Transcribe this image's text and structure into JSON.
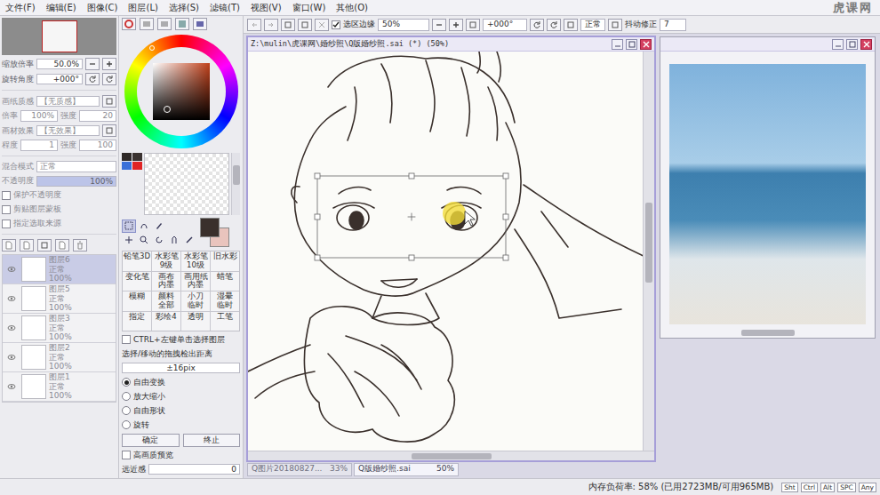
{
  "menu": [
    "文件(F)",
    "编辑(E)",
    "图像(C)",
    "图层(L)",
    "选择(S)",
    "滤镜(T)",
    "视图(V)",
    "窗口(W)",
    "其他(O)"
  ],
  "watermark": "虎课网",
  "toolbar": {
    "selection_edge": {
      "label": "选区边缘",
      "checked": true
    },
    "zoom": "50%",
    "rotation": "+000°",
    "blend": "正常",
    "stabilizer_label": "抖动修正",
    "stabilizer": "7"
  },
  "navigator": {
    "zoom_label": "缩放倍率",
    "zoom": "50.0%",
    "rotate_label": "旋转角度",
    "rotate": "+000°"
  },
  "texture": [
    {
      "kind": "select",
      "label": "画纸质感",
      "value": "【无质感】"
    },
    {
      "kind": "pair",
      "label": "倍率",
      "value": "100%",
      "label2": "强度",
      "value2": "20"
    },
    {
      "kind": "select",
      "label": "画材效果",
      "value": "【无效果】"
    },
    {
      "kind": "pair",
      "label": "程度",
      "value": "1",
      "label2": "强度",
      "value2": "100"
    }
  ],
  "layer_props": {
    "blend_label": "混合模式",
    "blend": "正常",
    "opacity_label": "不透明度",
    "opacity": "100%",
    "opacity_level": 1,
    "checks": [
      {
        "label": "保护不透明度",
        "checked": false
      },
      {
        "label": "剪贴图层蒙板",
        "checked": false
      },
      {
        "label": "指定选取来源",
        "checked": false
      }
    ]
  },
  "layers": [
    {
      "name": "图层6",
      "mode": "正常",
      "opacity": "100%",
      "selected": true,
      "visible": true
    },
    {
      "name": "图层5",
      "mode": "正常",
      "opacity": "100%",
      "selected": false,
      "visible": true
    },
    {
      "name": "图层3",
      "mode": "正常",
      "opacity": "100%",
      "selected": false,
      "visible": true
    },
    {
      "name": "图层2",
      "mode": "正常",
      "opacity": "100%",
      "selected": false,
      "visible": true
    },
    {
      "name": "图层1",
      "mode": "正常",
      "opacity": "100%",
      "selected": false,
      "visible": true
    }
  ],
  "colors": {
    "primary": "#3a302c",
    "secondary": "#e9c4bd"
  },
  "swatches": [
    {
      "color": "#2f2a28"
    },
    {
      "color": "#3a3230"
    },
    {
      "color": "#3a70d8"
    },
    {
      "color": "#e02424"
    }
  ],
  "brushes": [
    "铅笔3D",
    "水彩笔\n9级",
    "水彩笔\n10级",
    "旧水彩",
    "变化笔",
    "画布\n内墨",
    "画用纸\n内墨",
    "蜡笔",
    "模糊",
    "颜料\n全部",
    "小刀\n临时",
    "湿晕\n临时",
    "指定",
    "彩绘4",
    "透明",
    "工笔"
  ],
  "tool_options": {
    "ctrl_select": {
      "label": "CTRL+左键单击选择图层",
      "checked": false
    },
    "drag_label": "选择/移动的拖拽检出距离",
    "drag_value": "±16pix",
    "modes": [
      {
        "label": "自由变换",
        "selected": true
      },
      {
        "label": "放大缩小",
        "selected": false
      },
      {
        "label": "自由形状",
        "selected": false
      },
      {
        "label": "旋转",
        "selected": false
      }
    ],
    "buttons": [
      "确定",
      "终止"
    ],
    "hq_preview": {
      "label": "高画质预览",
      "checked": false
    },
    "perspective": {
      "label": "远近感",
      "value": "0"
    }
  },
  "canvas": {
    "title": "Z:\\mulin\\虎课网\\婚纱照\\Q版婚纱照.sai (*) (50%)",
    "tabs": [
      {
        "name": "Q图片20180827...",
        "zoom": "33%",
        "selected": false
      },
      {
        "name": "Q版婚纱照.sai",
        "zoom": "50%",
        "selected": true
      }
    ]
  },
  "status": {
    "memory": "内存负荷率: 58% (已用2723MB/可用965MB)",
    "keys": [
      "Sht",
      "Ctrl",
      "Alt",
      "SPC",
      "Any"
    ]
  }
}
